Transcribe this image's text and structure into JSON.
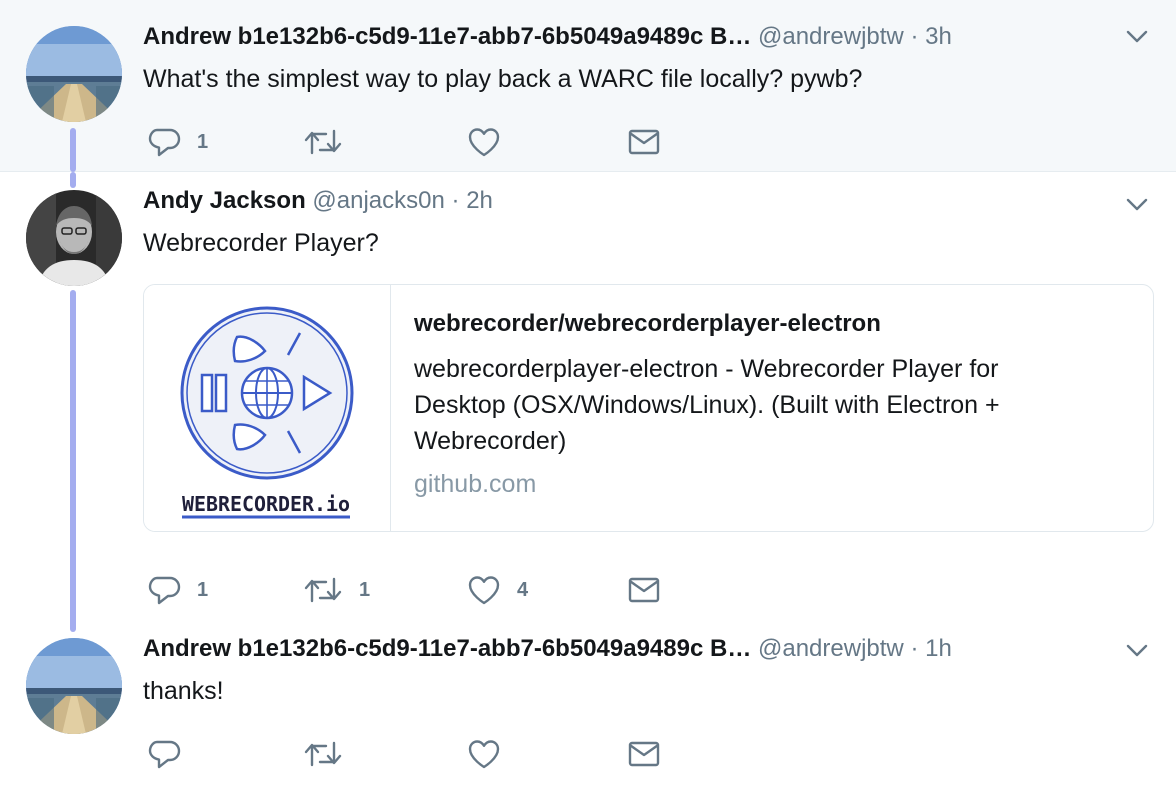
{
  "tweets": [
    {
      "name": "Andrew b1e132b6-c5d9-11e7-abb7-6b5049a9489c B…",
      "handle": "@andrewjbtw",
      "separator": "·",
      "time": "3h",
      "text": "What's the simplest way to play back a WARC file locally? pywb?",
      "actions": {
        "reply_count": "1",
        "retweet_count": "",
        "like_count": ""
      },
      "avatar": "landscape-avatar"
    },
    {
      "name": "Andy Jackson",
      "handle": "@anjacks0n",
      "separator": "·",
      "time": "2h",
      "text": "Webrecorder Player?",
      "card": {
        "title": "webrecorder/webrecorderplayer-electron",
        "description": "webrecorderplayer-electron - Webrecorder Player for Desktop (OSX/Windows/Linux). (Built with Electron + Webrecorder)",
        "domain": "github.com",
        "logo_text": "WEBRECORDER.io"
      },
      "actions": {
        "reply_count": "1",
        "retweet_count": "1",
        "like_count": "4"
      },
      "avatar": "portrait-avatar"
    },
    {
      "name": "Andrew b1e132b6-c5d9-11e7-abb7-6b5049a9489c B…",
      "handle": "@andrewjbtw",
      "separator": "·",
      "time": "1h",
      "text": "thanks!",
      "actions": {
        "reply_count": "",
        "retweet_count": "",
        "like_count": ""
      },
      "avatar": "landscape-avatar"
    }
  ],
  "icons": {
    "reply": "reply-icon",
    "retweet": "retweet-icon",
    "like": "heart-icon",
    "dm": "envelope-icon",
    "menu": "chevron-down-icon"
  },
  "colors": {
    "thread_line": "#a4adef",
    "secondary_text": "#657786",
    "highlight_bg": "#f5f8fa",
    "logo_blue": "#3b5bc8"
  }
}
